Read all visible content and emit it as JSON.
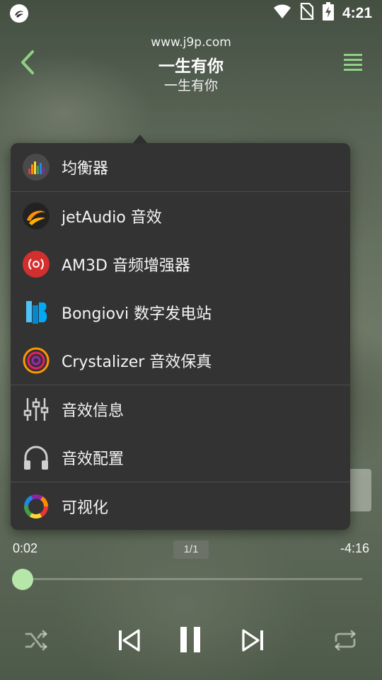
{
  "status_bar": {
    "time": "4:21",
    "icons": [
      "app-notification-icon",
      "wifi-icon",
      "no-sim-icon",
      "battery-charging-icon"
    ]
  },
  "header": {
    "site": "www.j9p.com",
    "title": "一生有你",
    "artist": "一生有你",
    "back_icon": "chevron-left-icon",
    "menu_icon": "menu-icon"
  },
  "menu": {
    "items": [
      {
        "label": "均衡器",
        "icon": "equalizer-icon"
      },
      {
        "label": "jetAudio 音效",
        "icon": "jetaudio-icon"
      },
      {
        "label": "AM3D 音频增强器",
        "icon": "am3d-icon"
      },
      {
        "label": "Bongiovi 数字发电站",
        "icon": "bongiovi-icon"
      },
      {
        "label": "Crystalizer 音效保真",
        "icon": "crystalizer-icon"
      },
      {
        "label": "音效信息",
        "icon": "sliders-icon"
      },
      {
        "label": "音效配置",
        "icon": "headphones-icon"
      },
      {
        "label": "可视化",
        "icon": "visualizer-icon"
      }
    ]
  },
  "player": {
    "elapsed": "0:02",
    "remaining": "-4:16",
    "page_indicator": "1/1",
    "progress": 0.008
  },
  "controls": {
    "icons": [
      "shuffle-icon",
      "previous-icon",
      "pause-icon",
      "next-icon",
      "repeat-icon"
    ]
  },
  "colors": {
    "accent": "#8fd086",
    "menu_bg": "#333333",
    "seek_thumb": "#b6e6a8"
  }
}
